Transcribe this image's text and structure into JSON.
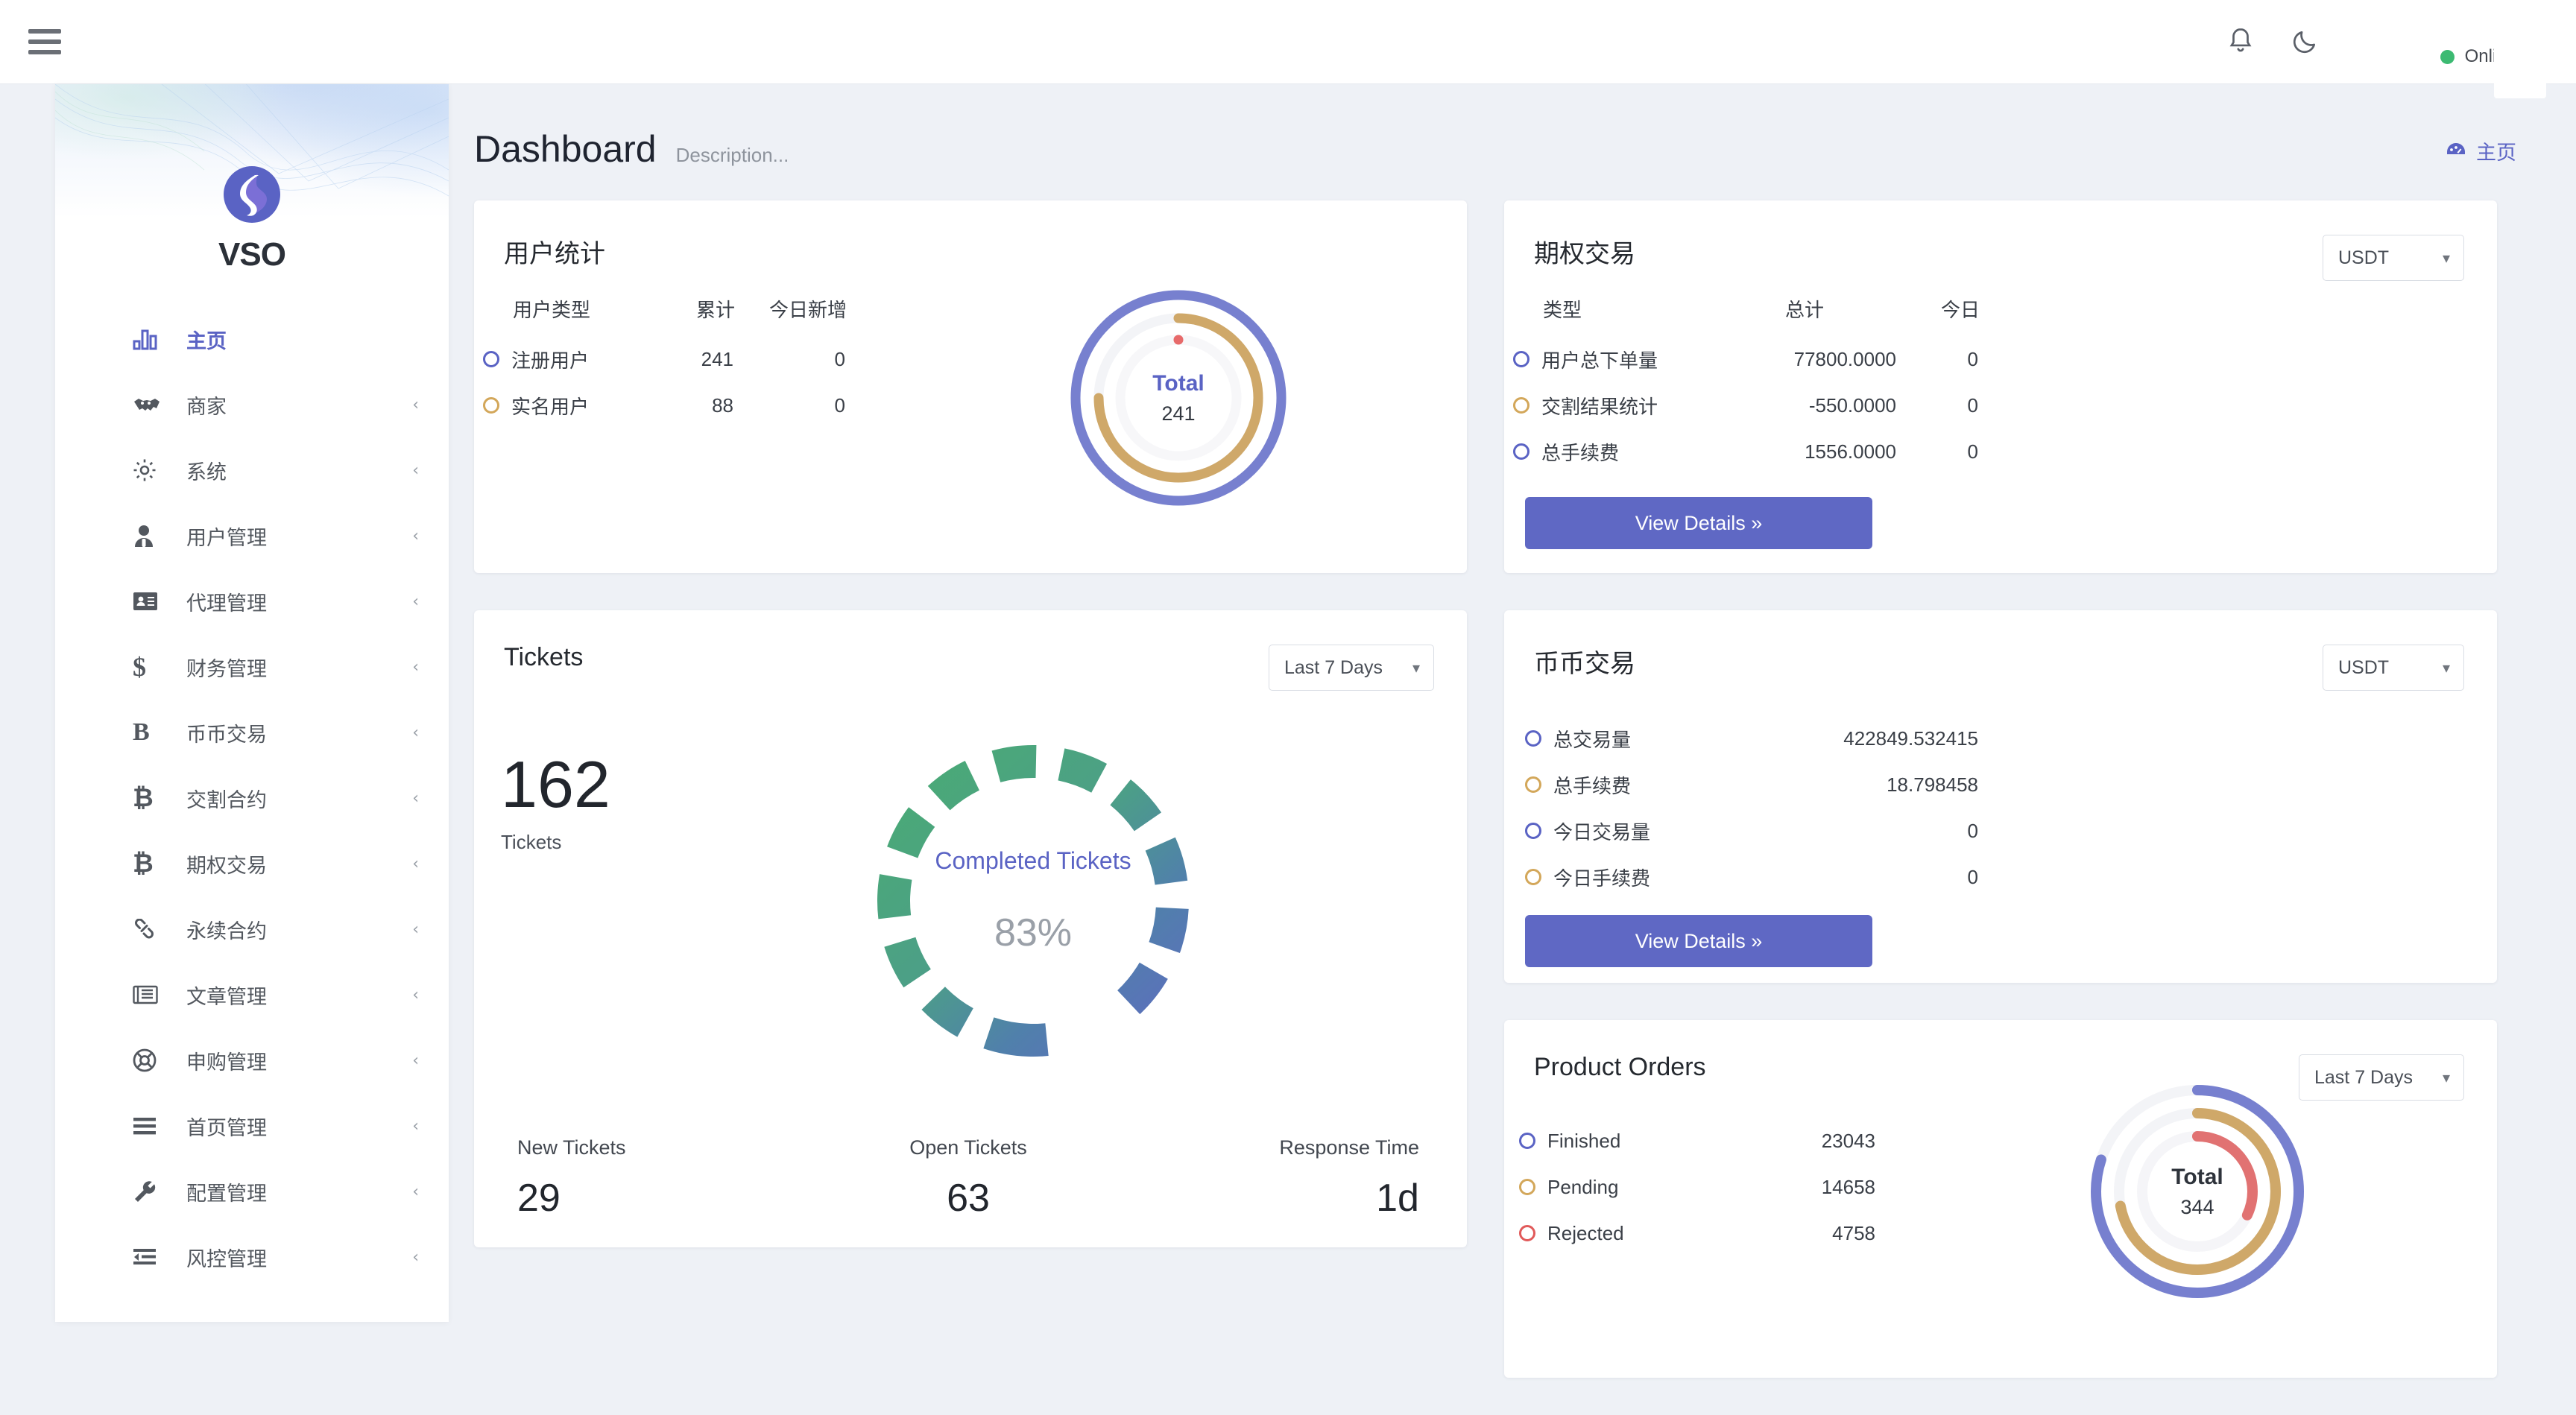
{
  "topbar": {
    "menu_icon": "hamburger-icon",
    "bell_icon": "notification-bell-icon",
    "theme_icon": "moon-icon",
    "status_label": "Online",
    "status_color": "#3cba72"
  },
  "sidebar": {
    "brand_name": "VSO",
    "items": [
      {
        "label": "主页",
        "icon": "bar-chart-icon",
        "active": true,
        "chevron": ""
      },
      {
        "label": "商家",
        "icon": "handshake-icon",
        "active": false,
        "chevron": "‹"
      },
      {
        "label": "系统",
        "icon": "gear-icon",
        "active": false,
        "chevron": "‹"
      },
      {
        "label": "用户管理",
        "icon": "user-icon",
        "active": false,
        "chevron": "‹"
      },
      {
        "label": "代理管理",
        "icon": "id-card-icon",
        "active": false,
        "chevron": "‹"
      },
      {
        "label": "财务管理",
        "icon": "dollar-icon",
        "active": false,
        "chevron": "‹"
      },
      {
        "label": "币币交易",
        "icon": "letter-b-icon",
        "active": false,
        "chevron": "‹"
      },
      {
        "label": "交割合约",
        "icon": "bitcoin-icon",
        "active": false,
        "chevron": "‹"
      },
      {
        "label": "期权交易",
        "icon": "bitcoin-icon",
        "active": false,
        "chevron": "‹"
      },
      {
        "label": "永续合约",
        "icon": "link-icon",
        "active": false,
        "chevron": "‹"
      },
      {
        "label": "文章管理",
        "icon": "newspaper-icon",
        "active": false,
        "chevron": "‹"
      },
      {
        "label": "申购管理",
        "icon": "lifebuoy-icon",
        "active": false,
        "chevron": "‹"
      },
      {
        "label": "首页管理",
        "icon": "list-icon",
        "active": false,
        "chevron": "‹"
      },
      {
        "label": "配置管理",
        "icon": "wrench-icon",
        "active": false,
        "chevron": "‹"
      },
      {
        "label": "风控管理",
        "icon": "indent-icon",
        "active": false,
        "chevron": "‹"
      }
    ]
  },
  "page": {
    "title": "Dashboard",
    "description": "Description...",
    "breadcrumb_icon": "dashboard-gauge-icon",
    "breadcrumb_label": "主页"
  },
  "user_stats": {
    "title": "用户统计",
    "headers": [
      "用户类型",
      "累计",
      "今日新增"
    ],
    "rows": [
      {
        "label": "注册用户",
        "total": "241",
        "today": "0",
        "color": "#5a63c4"
      },
      {
        "label": "实名用户",
        "total": "88",
        "today": "0",
        "color": "#d3a75a"
      }
    ],
    "donut_total_label": "Total",
    "donut_total_value": "241"
  },
  "options_trading": {
    "title": "期权交易",
    "currency": "USDT",
    "headers": [
      "类型",
      "总计",
      "今日"
    ],
    "rows": [
      {
        "label": "用户总下单量",
        "total": "77800.0000",
        "today": "0",
        "color": "#5a63c4"
      },
      {
        "label": "交割结果统计",
        "total": "-550.0000",
        "today": "0",
        "color": "#d3a75a"
      },
      {
        "label": "总手续费",
        "total": "1556.0000",
        "today": "0",
        "color": "#5a63c4"
      }
    ],
    "button_label": "View Details »"
  },
  "tickets": {
    "title": "Tickets",
    "range": "Last 7 Days",
    "count": "162",
    "count_label": "Tickets",
    "gauge_label": "Completed Tickets",
    "gauge_pct": "83%",
    "footer": [
      {
        "label": "New Tickets",
        "value": "29"
      },
      {
        "label": "Open Tickets",
        "value": "63"
      },
      {
        "label": "Response Time",
        "value": "1d"
      }
    ]
  },
  "coin_trading": {
    "title": "币币交易",
    "currency": "USDT",
    "rows": [
      {
        "label": "总交易量",
        "value": "422849.532415",
        "color": "#5a63c4"
      },
      {
        "label": "总手续费",
        "value": "18.798458",
        "color": "#d3a75a"
      },
      {
        "label": "今日交易量",
        "value": "0",
        "color": "#5a63c4"
      },
      {
        "label": "今日手续费",
        "value": "0",
        "color": "#d3a75a"
      }
    ],
    "button_label": "View Details »"
  },
  "product_orders": {
    "title": "Product Orders",
    "range": "Last 7 Days",
    "rows": [
      {
        "label": "Finished",
        "value": "23043",
        "color": "#5a63c4"
      },
      {
        "label": "Pending",
        "value": "14658",
        "color": "#d3a75a"
      },
      {
        "label": "Rejected",
        "value": "4758",
        "color": "#e15a5a"
      }
    ],
    "donut_total_label": "Total",
    "donut_total_value": "344"
  },
  "chart_data": [
    {
      "type": "pie",
      "name": "user-stats-donut",
      "title": "用户统计",
      "center_label": "Total",
      "center_value": 241,
      "rings": [
        {
          "name": "注册用户",
          "value": 241,
          "percent": 100,
          "color": "#7780cf"
        },
        {
          "name": "实名用户",
          "value": 88,
          "percent": 75,
          "color": "#cfa869"
        }
      ],
      "marker": {
        "color": "#e76a6a"
      }
    },
    {
      "type": "pie",
      "name": "completed-tickets-gauge",
      "title": "Completed Tickets",
      "value": 83,
      "unit": "%",
      "total_tickets": 162,
      "new_tickets": 29,
      "open_tickets": 63,
      "response_time": "1d",
      "segments": 44,
      "gradient": [
        "#4aab74",
        "#5f6cc0"
      ],
      "track_color": "#ffffff"
    },
    {
      "type": "pie",
      "name": "product-orders-donut",
      "title": "Product Orders",
      "center_label": "Total",
      "center_value": 344,
      "rings": [
        {
          "name": "Finished",
          "value": 23043,
          "percent": 80,
          "color": "#7780cf"
        },
        {
          "name": "Pending",
          "value": 14658,
          "percent": 72,
          "color": "#cfa869"
        },
        {
          "name": "Rejected",
          "value": 4758,
          "percent": 32,
          "color": "#e17272"
        }
      ]
    }
  ]
}
